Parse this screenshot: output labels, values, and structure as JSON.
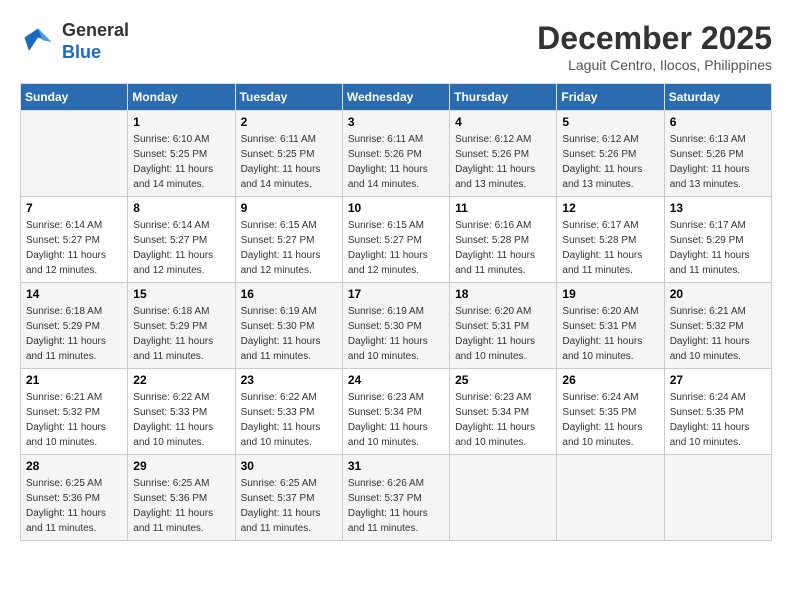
{
  "header": {
    "logo_general": "General",
    "logo_blue": "Blue",
    "month_year": "December 2025",
    "location": "Laguit Centro, Ilocos, Philippines"
  },
  "days_of_week": [
    "Sunday",
    "Monday",
    "Tuesday",
    "Wednesday",
    "Thursday",
    "Friday",
    "Saturday"
  ],
  "weeks": [
    [
      {
        "day": "",
        "info": ""
      },
      {
        "day": "1",
        "info": "Sunrise: 6:10 AM\nSunset: 5:25 PM\nDaylight: 11 hours\nand 14 minutes."
      },
      {
        "day": "2",
        "info": "Sunrise: 6:11 AM\nSunset: 5:25 PM\nDaylight: 11 hours\nand 14 minutes."
      },
      {
        "day": "3",
        "info": "Sunrise: 6:11 AM\nSunset: 5:26 PM\nDaylight: 11 hours\nand 14 minutes."
      },
      {
        "day": "4",
        "info": "Sunrise: 6:12 AM\nSunset: 5:26 PM\nDaylight: 11 hours\nand 13 minutes."
      },
      {
        "day": "5",
        "info": "Sunrise: 6:12 AM\nSunset: 5:26 PM\nDaylight: 11 hours\nand 13 minutes."
      },
      {
        "day": "6",
        "info": "Sunrise: 6:13 AM\nSunset: 5:26 PM\nDaylight: 11 hours\nand 13 minutes."
      }
    ],
    [
      {
        "day": "7",
        "info": "Sunrise: 6:14 AM\nSunset: 5:27 PM\nDaylight: 11 hours\nand 12 minutes."
      },
      {
        "day": "8",
        "info": "Sunrise: 6:14 AM\nSunset: 5:27 PM\nDaylight: 11 hours\nand 12 minutes."
      },
      {
        "day": "9",
        "info": "Sunrise: 6:15 AM\nSunset: 5:27 PM\nDaylight: 11 hours\nand 12 minutes."
      },
      {
        "day": "10",
        "info": "Sunrise: 6:15 AM\nSunset: 5:27 PM\nDaylight: 11 hours\nand 12 minutes."
      },
      {
        "day": "11",
        "info": "Sunrise: 6:16 AM\nSunset: 5:28 PM\nDaylight: 11 hours\nand 11 minutes."
      },
      {
        "day": "12",
        "info": "Sunrise: 6:17 AM\nSunset: 5:28 PM\nDaylight: 11 hours\nand 11 minutes."
      },
      {
        "day": "13",
        "info": "Sunrise: 6:17 AM\nSunset: 5:29 PM\nDaylight: 11 hours\nand 11 minutes."
      }
    ],
    [
      {
        "day": "14",
        "info": "Sunrise: 6:18 AM\nSunset: 5:29 PM\nDaylight: 11 hours\nand 11 minutes."
      },
      {
        "day": "15",
        "info": "Sunrise: 6:18 AM\nSunset: 5:29 PM\nDaylight: 11 hours\nand 11 minutes."
      },
      {
        "day": "16",
        "info": "Sunrise: 6:19 AM\nSunset: 5:30 PM\nDaylight: 11 hours\nand 11 minutes."
      },
      {
        "day": "17",
        "info": "Sunrise: 6:19 AM\nSunset: 5:30 PM\nDaylight: 11 hours\nand 10 minutes."
      },
      {
        "day": "18",
        "info": "Sunrise: 6:20 AM\nSunset: 5:31 PM\nDaylight: 11 hours\nand 10 minutes."
      },
      {
        "day": "19",
        "info": "Sunrise: 6:20 AM\nSunset: 5:31 PM\nDaylight: 11 hours\nand 10 minutes."
      },
      {
        "day": "20",
        "info": "Sunrise: 6:21 AM\nSunset: 5:32 PM\nDaylight: 11 hours\nand 10 minutes."
      }
    ],
    [
      {
        "day": "21",
        "info": "Sunrise: 6:21 AM\nSunset: 5:32 PM\nDaylight: 11 hours\nand 10 minutes."
      },
      {
        "day": "22",
        "info": "Sunrise: 6:22 AM\nSunset: 5:33 PM\nDaylight: 11 hours\nand 10 minutes."
      },
      {
        "day": "23",
        "info": "Sunrise: 6:22 AM\nSunset: 5:33 PM\nDaylight: 11 hours\nand 10 minutes."
      },
      {
        "day": "24",
        "info": "Sunrise: 6:23 AM\nSunset: 5:34 PM\nDaylight: 11 hours\nand 10 minutes."
      },
      {
        "day": "25",
        "info": "Sunrise: 6:23 AM\nSunset: 5:34 PM\nDaylight: 11 hours\nand 10 minutes."
      },
      {
        "day": "26",
        "info": "Sunrise: 6:24 AM\nSunset: 5:35 PM\nDaylight: 11 hours\nand 10 minutes."
      },
      {
        "day": "27",
        "info": "Sunrise: 6:24 AM\nSunset: 5:35 PM\nDaylight: 11 hours\nand 10 minutes."
      }
    ],
    [
      {
        "day": "28",
        "info": "Sunrise: 6:25 AM\nSunset: 5:36 PM\nDaylight: 11 hours\nand 11 minutes."
      },
      {
        "day": "29",
        "info": "Sunrise: 6:25 AM\nSunset: 5:36 PM\nDaylight: 11 hours\nand 11 minutes."
      },
      {
        "day": "30",
        "info": "Sunrise: 6:25 AM\nSunset: 5:37 PM\nDaylight: 11 hours\nand 11 minutes."
      },
      {
        "day": "31",
        "info": "Sunrise: 6:26 AM\nSunset: 5:37 PM\nDaylight: 11 hours\nand 11 minutes."
      },
      {
        "day": "",
        "info": ""
      },
      {
        "day": "",
        "info": ""
      },
      {
        "day": "",
        "info": ""
      }
    ]
  ]
}
